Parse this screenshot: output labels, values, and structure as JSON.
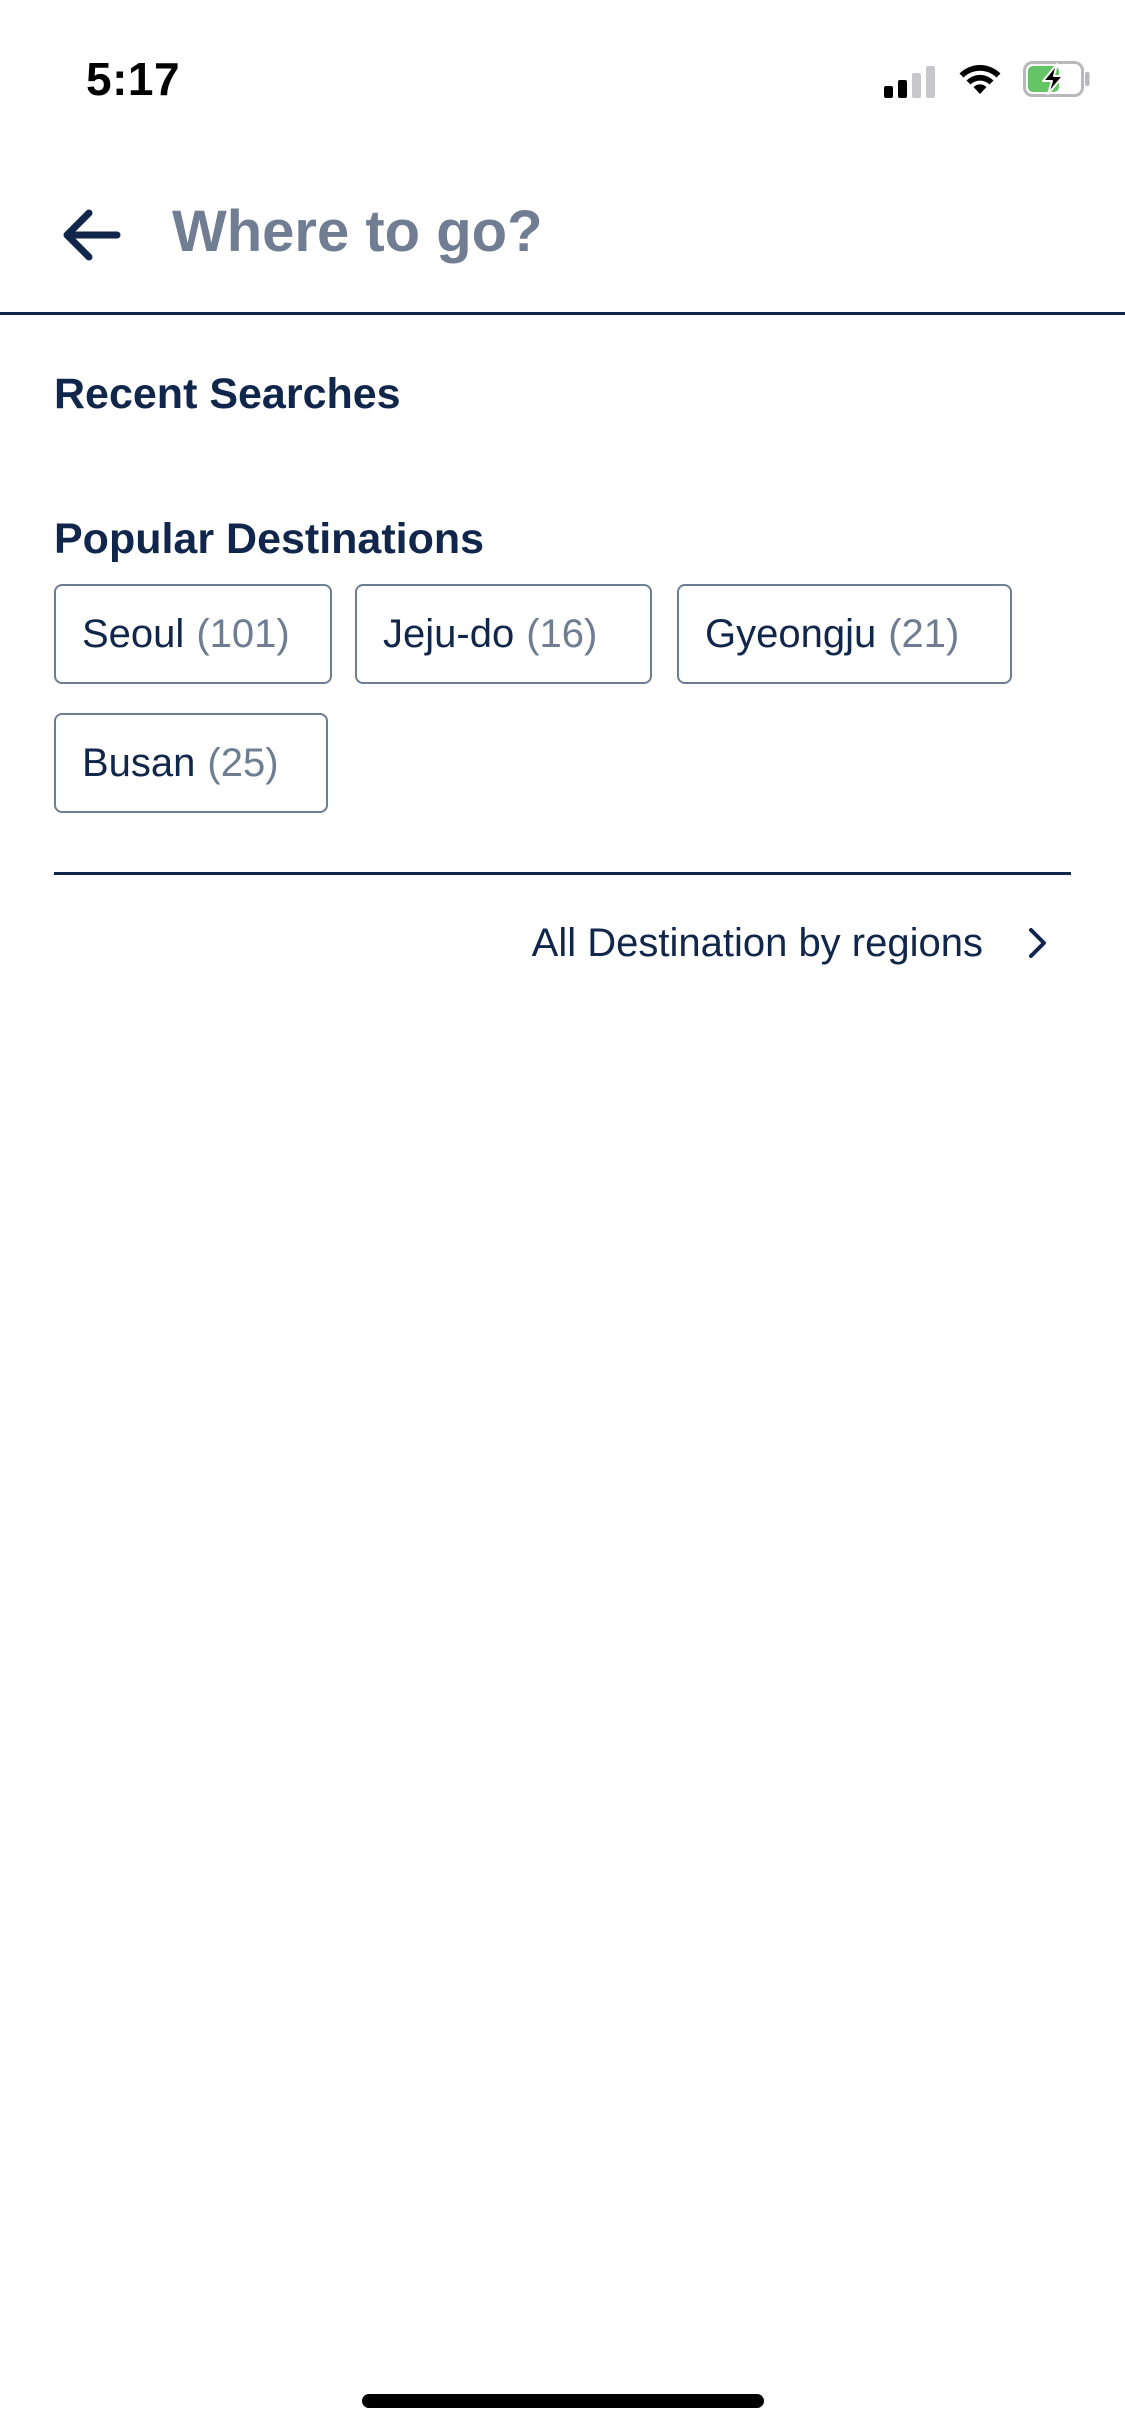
{
  "status_bar": {
    "time": "5:17",
    "icons": [
      "cellular-signal-icon",
      "wifi-icon",
      "battery-charging-icon"
    ],
    "signal_bars_active": 2,
    "signal_bars_total": 4,
    "battery_level": 0.6
  },
  "header": {
    "back_icon": "arrow-left-icon",
    "search_placeholder": "Where to go?",
    "search_value": ""
  },
  "recent_searches": {
    "title": "Recent Searches",
    "items": []
  },
  "popular_destinations": {
    "title": "Popular Destinations",
    "items": [
      {
        "name": "Seoul",
        "count": "(101)"
      },
      {
        "name": "Jeju-do",
        "count": "(16)"
      },
      {
        "name": "Gyeongju",
        "count": "(21)"
      },
      {
        "name": "Busan",
        "count": "(25)"
      }
    ]
  },
  "all_destinations_link": {
    "label": "All Destination by regions",
    "icon": "chevron-right-icon"
  },
  "colors": {
    "primary_text": "#10264a",
    "secondary_text": "#6f7d93",
    "placeholder": "#707d92",
    "chip_border": "#6f7d93",
    "battery_green": "#65c466",
    "background": "#ffffff"
  }
}
